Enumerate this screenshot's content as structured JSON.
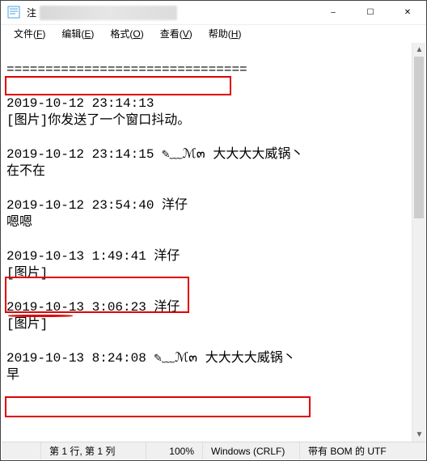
{
  "titlebar": {
    "prefix": "注",
    "redacted_hint": "redacted-title"
  },
  "window_buttons": {
    "minimize": "–",
    "maximize": "☐",
    "close": "✕"
  },
  "menubar": [
    {
      "label": "文件",
      "accel": "F"
    },
    {
      "label": "编辑",
      "accel": "E"
    },
    {
      "label": "格式",
      "accel": "O"
    },
    {
      "label": "查看",
      "accel": "V"
    },
    {
      "label": "帮助",
      "accel": "H"
    }
  ],
  "content": {
    "separator": "===============================",
    "lines": [
      "2019-10-12 23:14:13",
      "[图片]你发送了一个窗口抖动。",
      "",
      "2019-10-12 23:14:15 ✎﹏ℳ๓ 大大大大威锅丶",
      "在不在",
      "",
      "2019-10-12 23:54:40 洋仔",
      "嗯嗯",
      "",
      "2019-10-13 1:49:41 洋仔",
      "[图片]",
      "",
      "2019-10-13 3:06:23 洋仔",
      "[图片]",
      "",
      "2019-10-13 8:24:08 ✎﹏ℳ๓ 大大大大威锅丶",
      "早"
    ]
  },
  "statusbar": {
    "position": "第 1 行,  第 1 列",
    "zoom": "100%",
    "crlf": "Windows (CRLF)",
    "encoding": "带有 BOM 的 UTF"
  }
}
